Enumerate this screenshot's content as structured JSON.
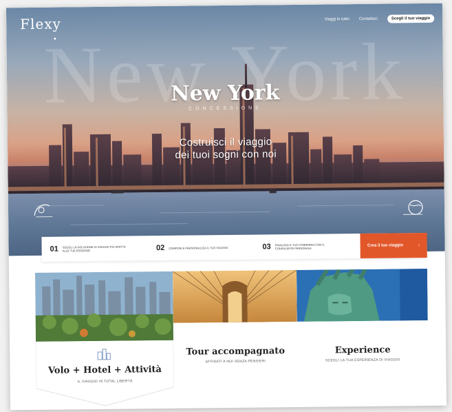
{
  "header": {
    "logo": "Flexy",
    "nav": [
      "Viaggi in tutto",
      "Contattaci"
    ],
    "cta": "Scegli il tuo viaggio"
  },
  "hero": {
    "watermark": "New York",
    "city": "New York",
    "city_sub": "CONCESSIONE",
    "slogan_line1": "Costruisci il viaggio",
    "slogan_line2": "dei tuoi sogni con noi"
  },
  "steps": [
    {
      "num": "01",
      "text": "SCEGLI LA SOLUZIONE DI VIAGGIO PIÙ ADATTA ALLE TUE ESIGENZE"
    },
    {
      "num": "02",
      "text": "COMPONI E PERSONALIZZA IL TUO VIAGGIO"
    },
    {
      "num": "03",
      "text": "FINALIZZA IL TUO ITINERARIO CON IL CONSULENTE PERSONALE"
    }
  ],
  "steps_cta": "Crea il tuo viaggio",
  "steps_cta_arrow": "↓",
  "products": [
    {
      "title": "Volo + Hotel + Attività",
      "subtitle": "IL VIAGGIO IN TOTAL LIBERTÀ"
    },
    {
      "title": "Tour accompagnato",
      "subtitle": "AFFIDATI A NOI SENZA PENSIERI"
    },
    {
      "title": "Experience",
      "subtitle": "SCEGLI LA TUA ESPERIENZA DI VIAGGIO"
    }
  ],
  "colors": {
    "accent": "#e2572a",
    "text": "#222222"
  }
}
